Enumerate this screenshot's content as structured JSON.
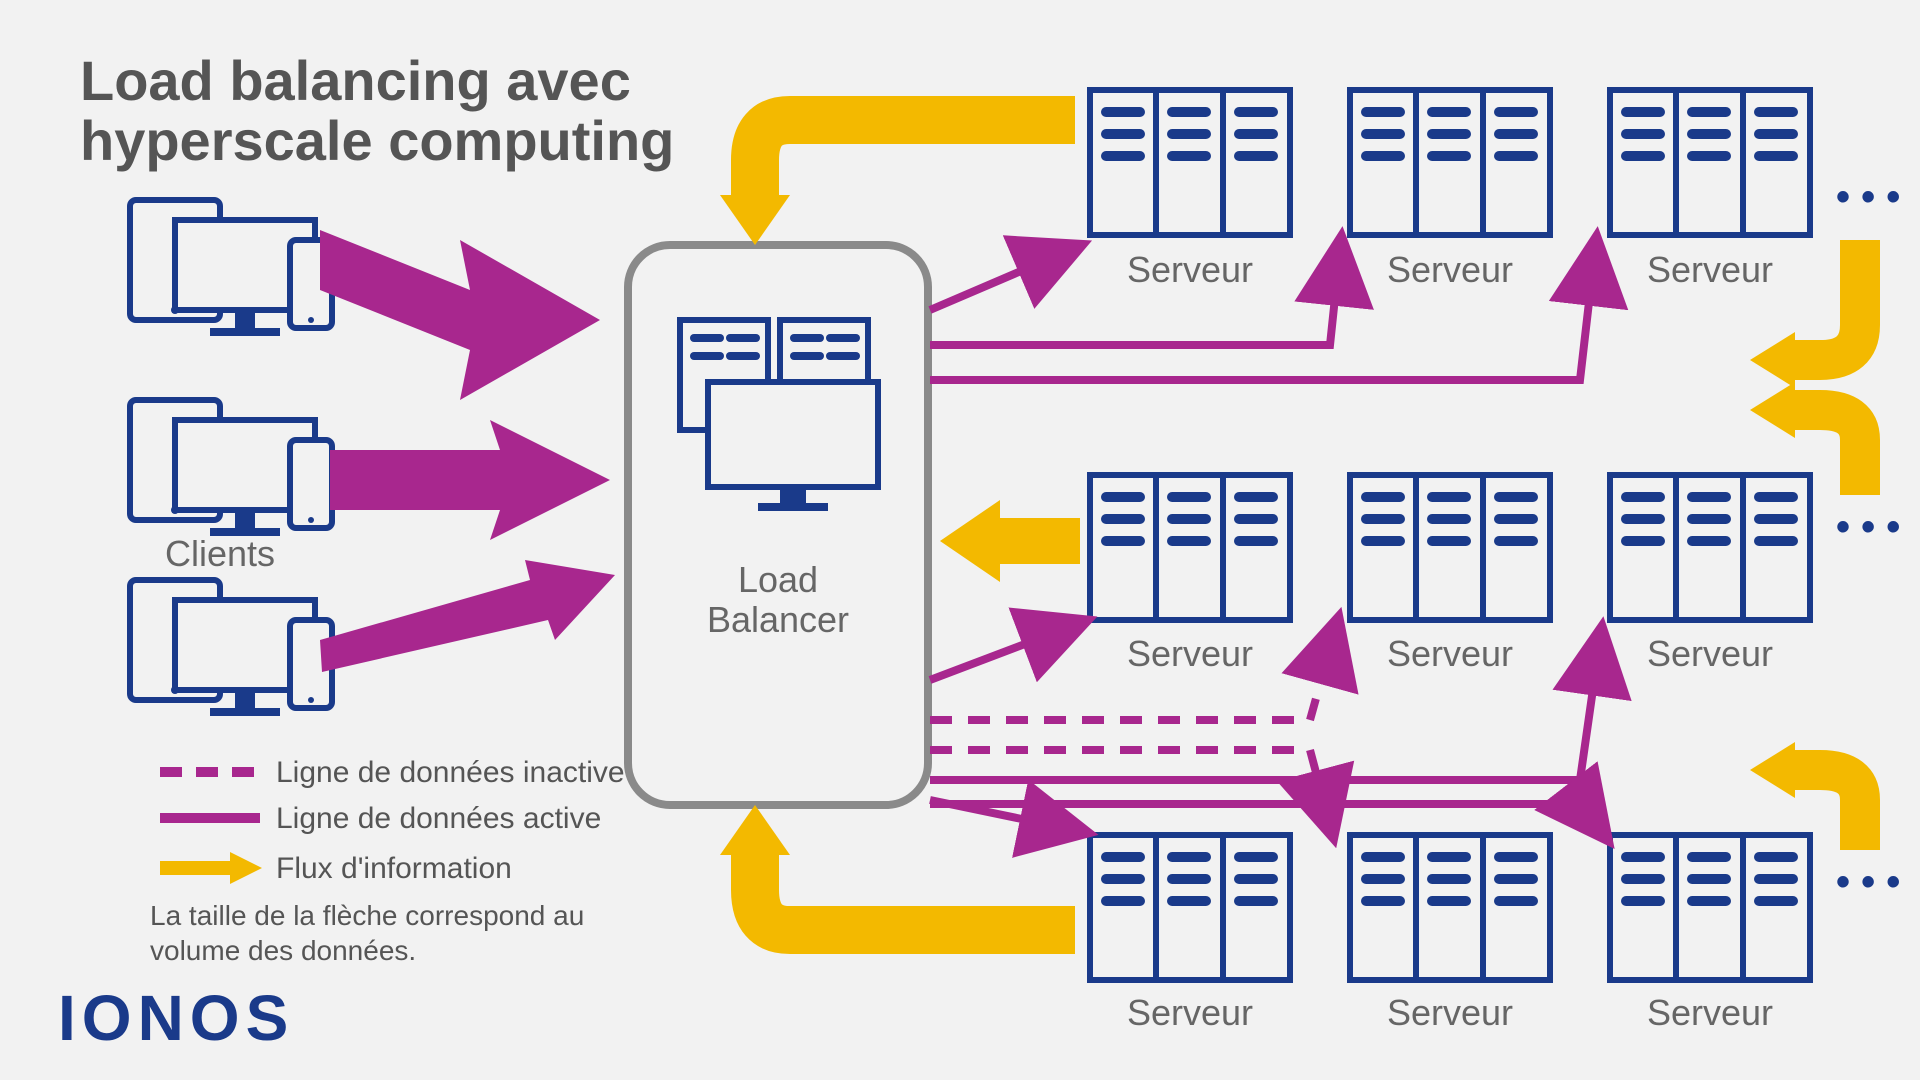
{
  "title_line1": "Load balancing avec",
  "title_line2": "hyperscale computing",
  "clients_label": "Clients",
  "load_balancer_line1": "Load",
  "load_balancer_line2": "Balancer",
  "server_label": "Serveur",
  "legend": {
    "inactive": "Ligne de données inactive",
    "active": "Ligne de données active",
    "flow": "Flux d'information"
  },
  "note_line1": "La taille de la flèche correspond au",
  "note_line2": "volume des données.",
  "logo": "IONOS",
  "ellipsis": "• • •",
  "colors": {
    "magenta": "#a8278e",
    "yellow": "#f3b900",
    "navy": "#1a3a8a",
    "grey": "#8a8a8a",
    "text": "#555"
  }
}
